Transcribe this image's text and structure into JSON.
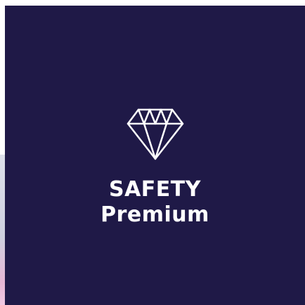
{
  "card": {
    "background": "#1f1947",
    "icon": "diamond-icon",
    "line1": "SAFETY",
    "line2": "Premium"
  }
}
